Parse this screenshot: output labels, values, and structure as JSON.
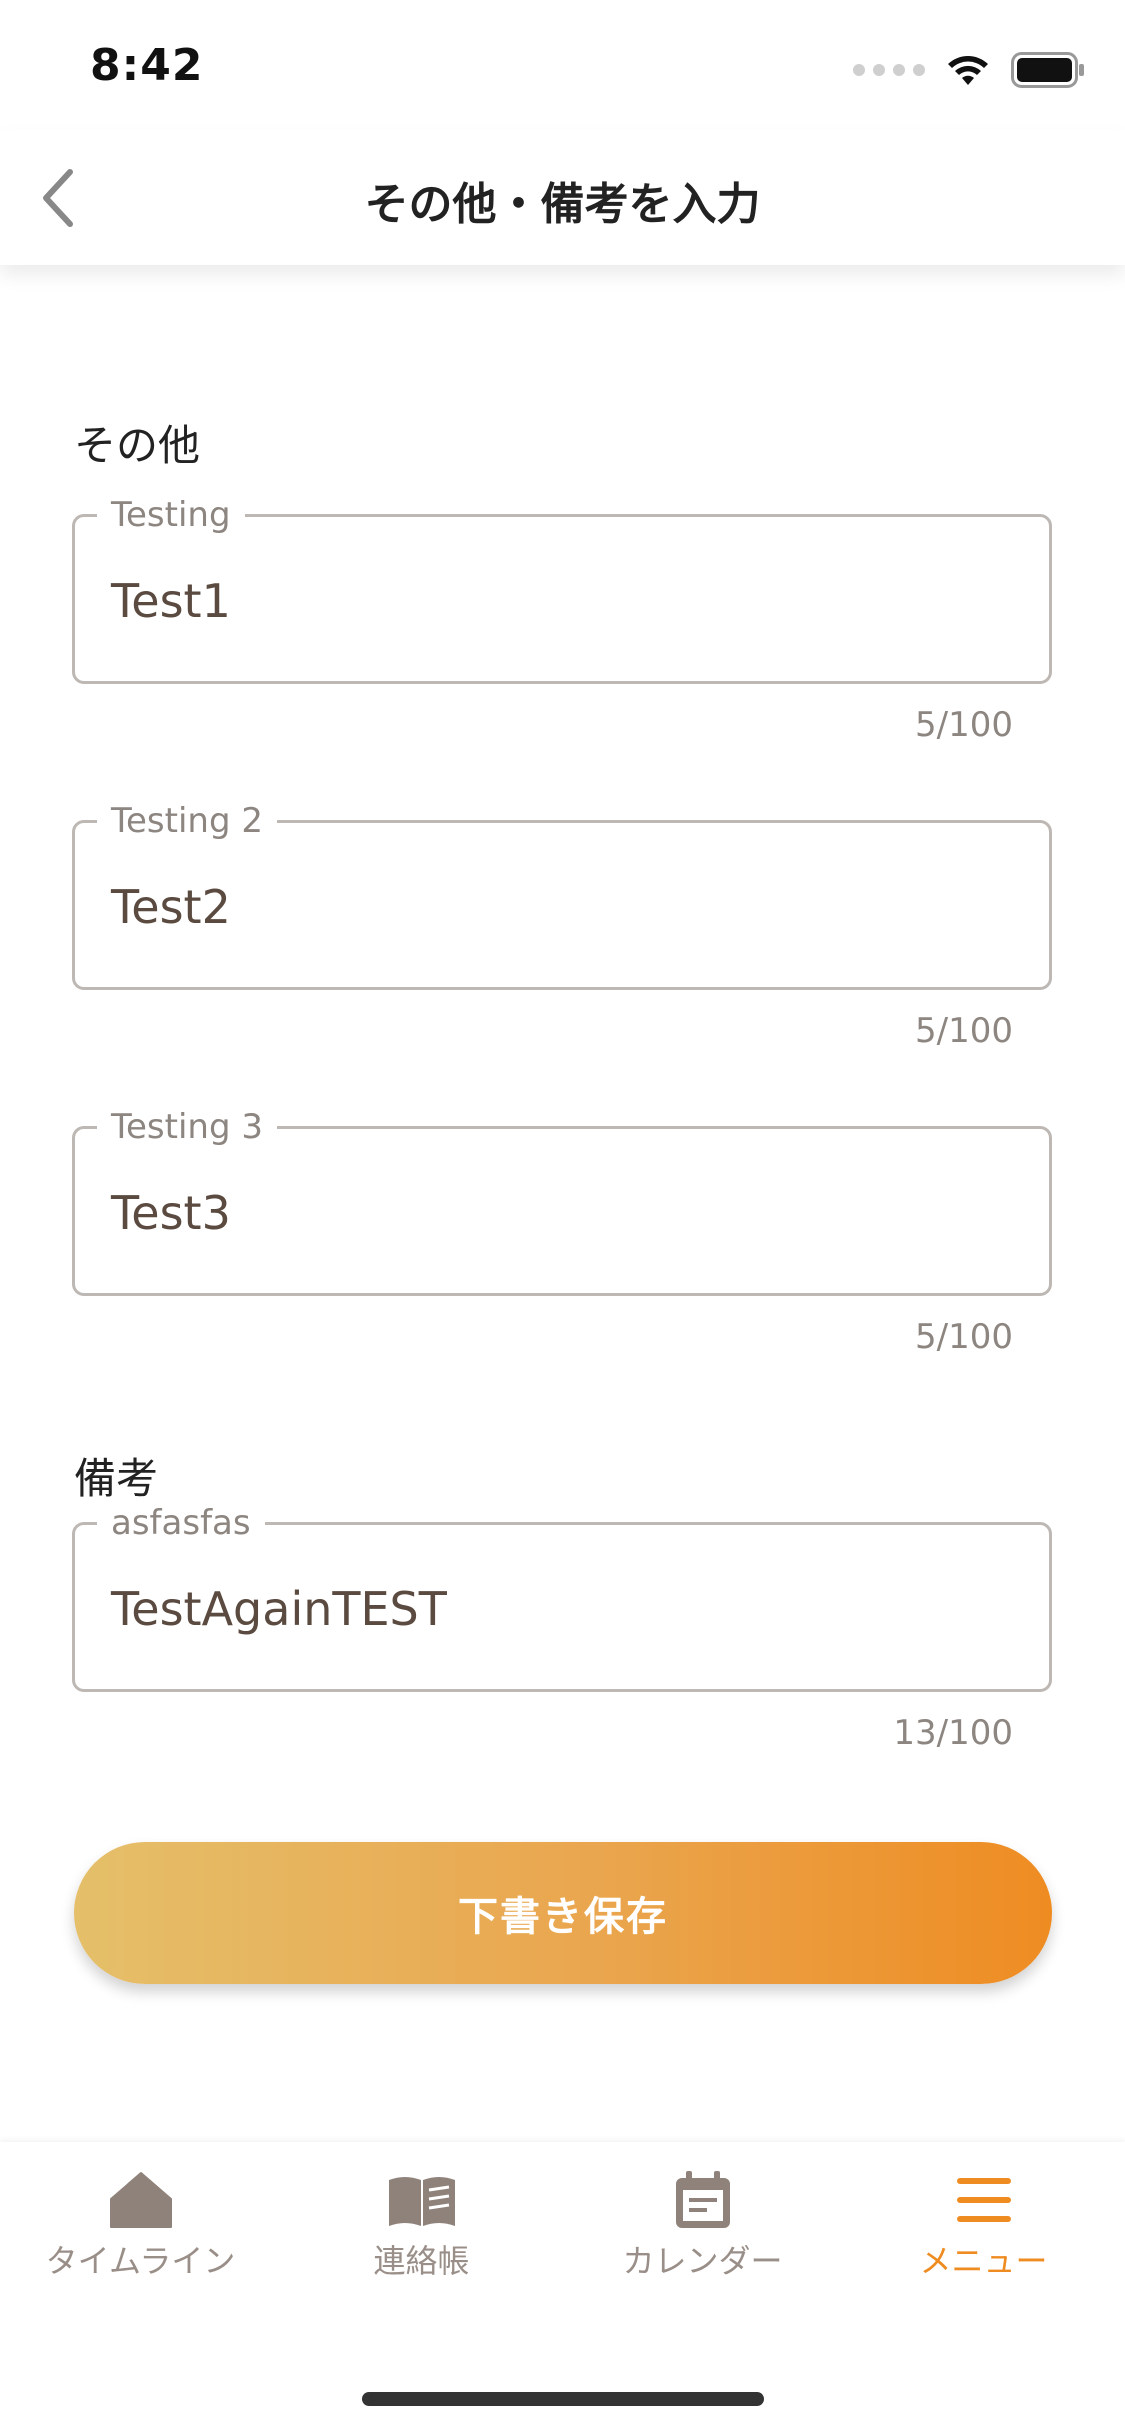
{
  "status_bar": {
    "time": "8:42"
  },
  "nav": {
    "title": "その他・備考を入力"
  },
  "sections": {
    "other_label": "その他",
    "remarks_label": "備考"
  },
  "fields": [
    {
      "label": "Testing",
      "value": "Test1",
      "counter": "5/100"
    },
    {
      "label": "Testing 2",
      "value": "Test2",
      "counter": "5/100"
    },
    {
      "label": "Testing 3",
      "value": "Test3",
      "counter": "5/100"
    },
    {
      "label": "asfasfas",
      "value": "TestAgainTEST",
      "counter": "13/100"
    }
  ],
  "save_button": {
    "label": "下書き保存"
  },
  "tabs": [
    {
      "label": "タイムライン",
      "icon": "home-icon"
    },
    {
      "label": "連絡帳",
      "icon": "book-icon"
    },
    {
      "label": "カレンダー",
      "icon": "calendar-icon"
    },
    {
      "label": "メニュー",
      "icon": "menu-icon",
      "active": true
    }
  ],
  "colors": {
    "accent": "#ee8c22",
    "tab_inactive": "#9a8f88",
    "gradient_start": "#e5bf6a"
  }
}
